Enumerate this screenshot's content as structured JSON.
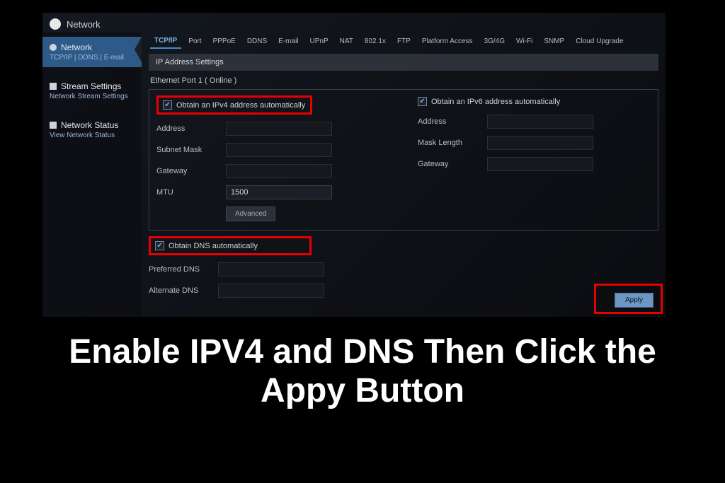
{
  "top": {
    "title": "Network"
  },
  "sidebar": {
    "network": {
      "label": "Network",
      "sub": "TCP/IP | DDNS | E-mail"
    },
    "stream": {
      "label": "Stream Settings",
      "sub": "Network Stream Settings"
    },
    "status": {
      "label": "Network Status",
      "sub": "View Network Status"
    }
  },
  "tabs": [
    "TCP/IP",
    "Port",
    "PPPoE",
    "DDNS",
    "E-mail",
    "UPnP",
    "NAT",
    "802.1x",
    "FTP",
    "Platform Access",
    "3G/4G",
    "Wi-Fi",
    "SNMP",
    "Cloud Upgrade"
  ],
  "section_header": "IP Address Settings",
  "port_label": "Ethernet Port 1 ( Online )",
  "ipv4": {
    "auto_label": "Obtain an IPv4 address automatically",
    "address_label": "Address",
    "subnet_label": "Subnet Mask",
    "gateway_label": "Gateway",
    "mtu_label": "MTU",
    "mtu_value": "1500",
    "advanced": "Advanced"
  },
  "ipv6": {
    "auto_label": "Obtain an IPv6 address automatically",
    "address_label": "Address",
    "mask_label": "Mask Length",
    "gateway_label": "Gateway"
  },
  "dns": {
    "auto_label": "Obtain DNS automatically",
    "preferred_label": "Preferred DNS",
    "alternate_label": "Alternate DNS"
  },
  "apply_label": "Apply",
  "caption": "Enable IPV4 and DNS Then Click the Appy Button"
}
